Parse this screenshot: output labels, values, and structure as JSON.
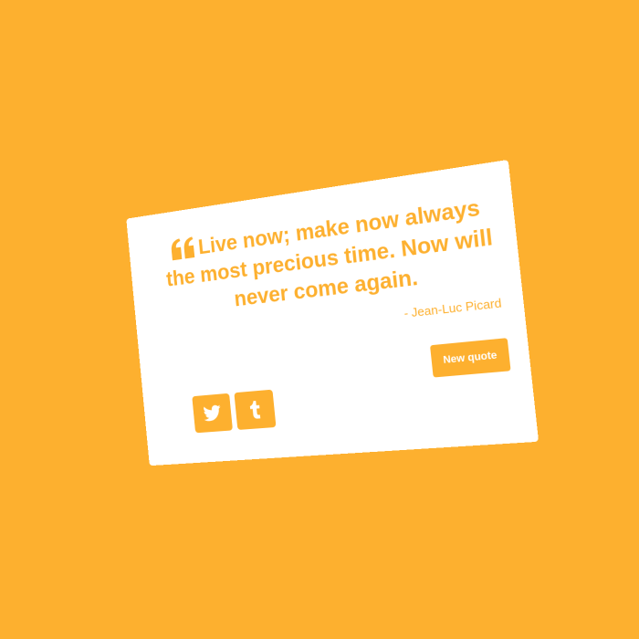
{
  "colors": {
    "background": "#FDB02F",
    "card": "#FFFFFF",
    "accent": "#FDB02F"
  },
  "quote": {
    "text": "Live now; make now always the most precious time. Now will never come again.",
    "author": "- Jean-Luc Picard",
    "icon": "quote-left-icon"
  },
  "actions": {
    "new_quote_label": "New quote"
  },
  "share": {
    "twitter_icon": "twitter-icon",
    "tumblr_icon": "tumblr-icon"
  }
}
